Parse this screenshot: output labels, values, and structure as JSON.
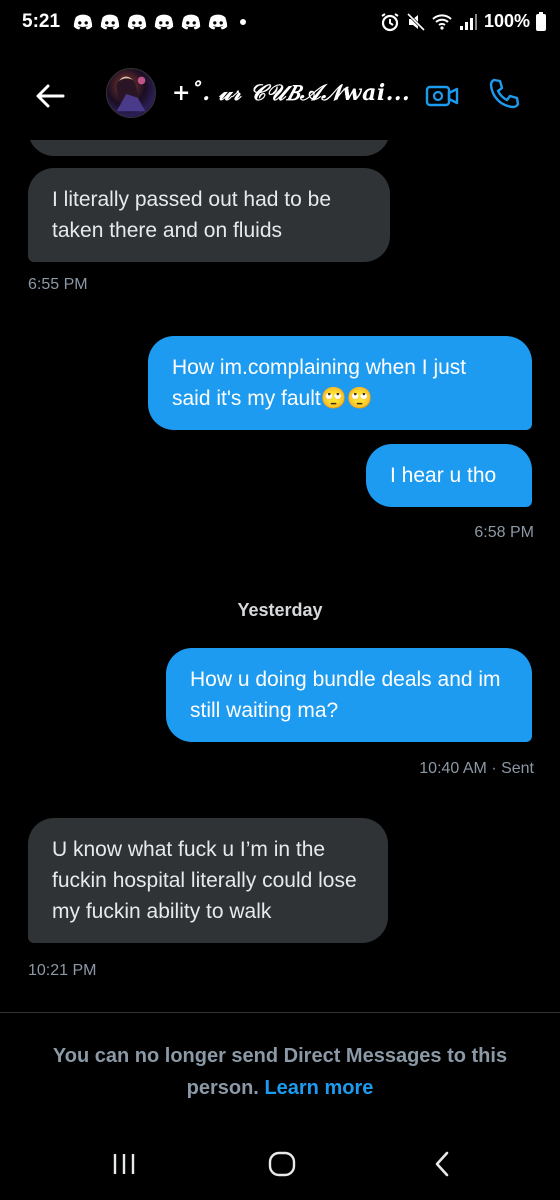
{
  "status_bar": {
    "time": "5:21",
    "battery": "100%",
    "notification_icons": [
      "discord-icon",
      "discord-icon",
      "discord-icon",
      "discord-icon",
      "discord-icon",
      "discord-icon"
    ],
    "system_icons": [
      "alarm-icon",
      "mute-icon",
      "wifi-icon",
      "signal-icon",
      "battery-icon"
    ]
  },
  "header": {
    "contact_name": "+˚. 𝓊𝓇 𝒞𝒰𝐵𝒜𝒩wai..."
  },
  "messages": [
    {
      "direction": "in",
      "text": "I literally passed out had to be taken there and on fluids",
      "time": "6:55 PM"
    },
    {
      "direction": "out",
      "text": "How im.complaining when I just said it's my fault🙄🙄"
    },
    {
      "direction": "out",
      "text": "I hear u tho",
      "time": "6:58 PM"
    },
    {
      "direction": "out",
      "text": "How u doing bundle deals and im still waiting ma?",
      "time": "10:40 AM · Sent"
    },
    {
      "direction": "in",
      "text": "U know what fuck u I’m in the fuckin hospital literally could lose my fuckin ability to walk",
      "time": "10:21 PM"
    }
  ],
  "day_separator": "Yesterday",
  "footer": {
    "notice": "You can no longer send Direct Messages to this person.",
    "learn_more": "Learn more"
  },
  "colors": {
    "background": "#000000",
    "incoming_bubble": "#2f3336",
    "outgoing_bubble": "#1d9bf0",
    "muted_text": "#8b98a5",
    "link": "#1d9bf0"
  }
}
